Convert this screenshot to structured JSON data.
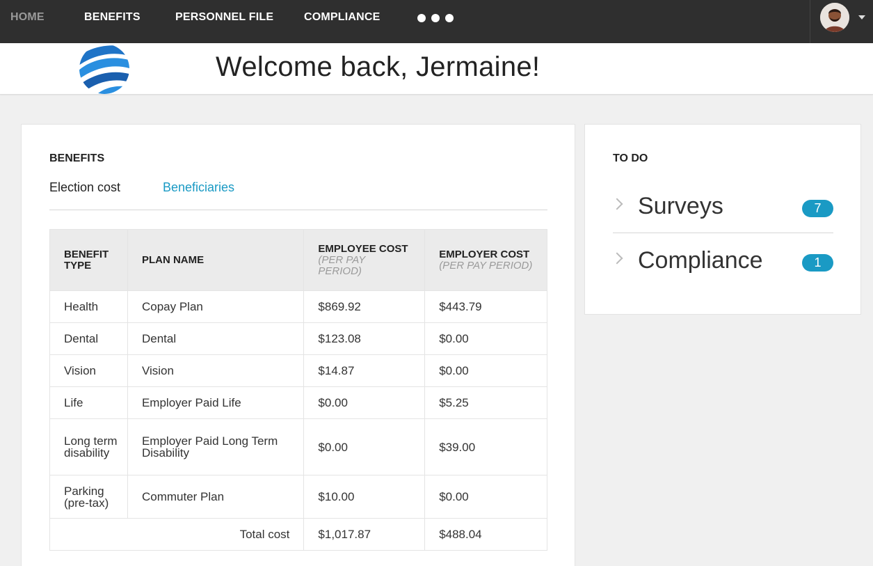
{
  "nav": {
    "home": "HOME",
    "benefits": "BENEFITS",
    "personnel_file": "PERSONNEL FILE",
    "compliance": "COMPLIANCE"
  },
  "header": {
    "welcome": "Welcome back, Jermaine!"
  },
  "benefits": {
    "title": "BENEFITS",
    "tabs": {
      "election_cost": "Election cost",
      "beneficiaries": "Beneficiaries"
    },
    "columns": {
      "benefit_type": "BENEFIT TYPE",
      "plan_name": "PLAN NAME",
      "employee_cost": "EMPLOYEE COST",
      "employer_cost": "EMPLOYER COST",
      "per_pay_period": "(PER PAY PERIOD)"
    },
    "rows": [
      {
        "type": "Health",
        "plan": "Copay Plan",
        "employee": "$869.92",
        "employer": "$443.79"
      },
      {
        "type": "Dental",
        "plan": "Dental",
        "employee": "$123.08",
        "employer": "$0.00"
      },
      {
        "type": "Vision",
        "plan": "Vision",
        "employee": "$14.87",
        "employer": "$0.00"
      },
      {
        "type": "Life",
        "plan": "Employer Paid Life",
        "employee": "$0.00",
        "employer": "$5.25"
      },
      {
        "type": "Long term disability",
        "plan": "Employer Paid Long Term Disability",
        "employee": "$0.00",
        "employer": "$39.00"
      },
      {
        "type": "Parking (pre-tax)",
        "plan": "Commuter Plan",
        "employee": "$10.00",
        "employer": "$0.00"
      }
    ],
    "total": {
      "label": "Total cost",
      "employee": "$1,017.87",
      "employer": "$488.04"
    }
  },
  "todo": {
    "title": "TO DO",
    "items": [
      {
        "label": "Surveys",
        "count": "7"
      },
      {
        "label": "Compliance",
        "count": "1"
      }
    ]
  },
  "colors": {
    "nav_bg": "#2f2f2f",
    "accent": "#1a9ac4",
    "page_bg": "#f0f0f0"
  },
  "icons": {
    "more": "more-dots-icon",
    "avatar": "user-avatar",
    "caret": "caret-down-icon",
    "chevron": "chevron-right-icon",
    "logo": "globe-logo"
  }
}
